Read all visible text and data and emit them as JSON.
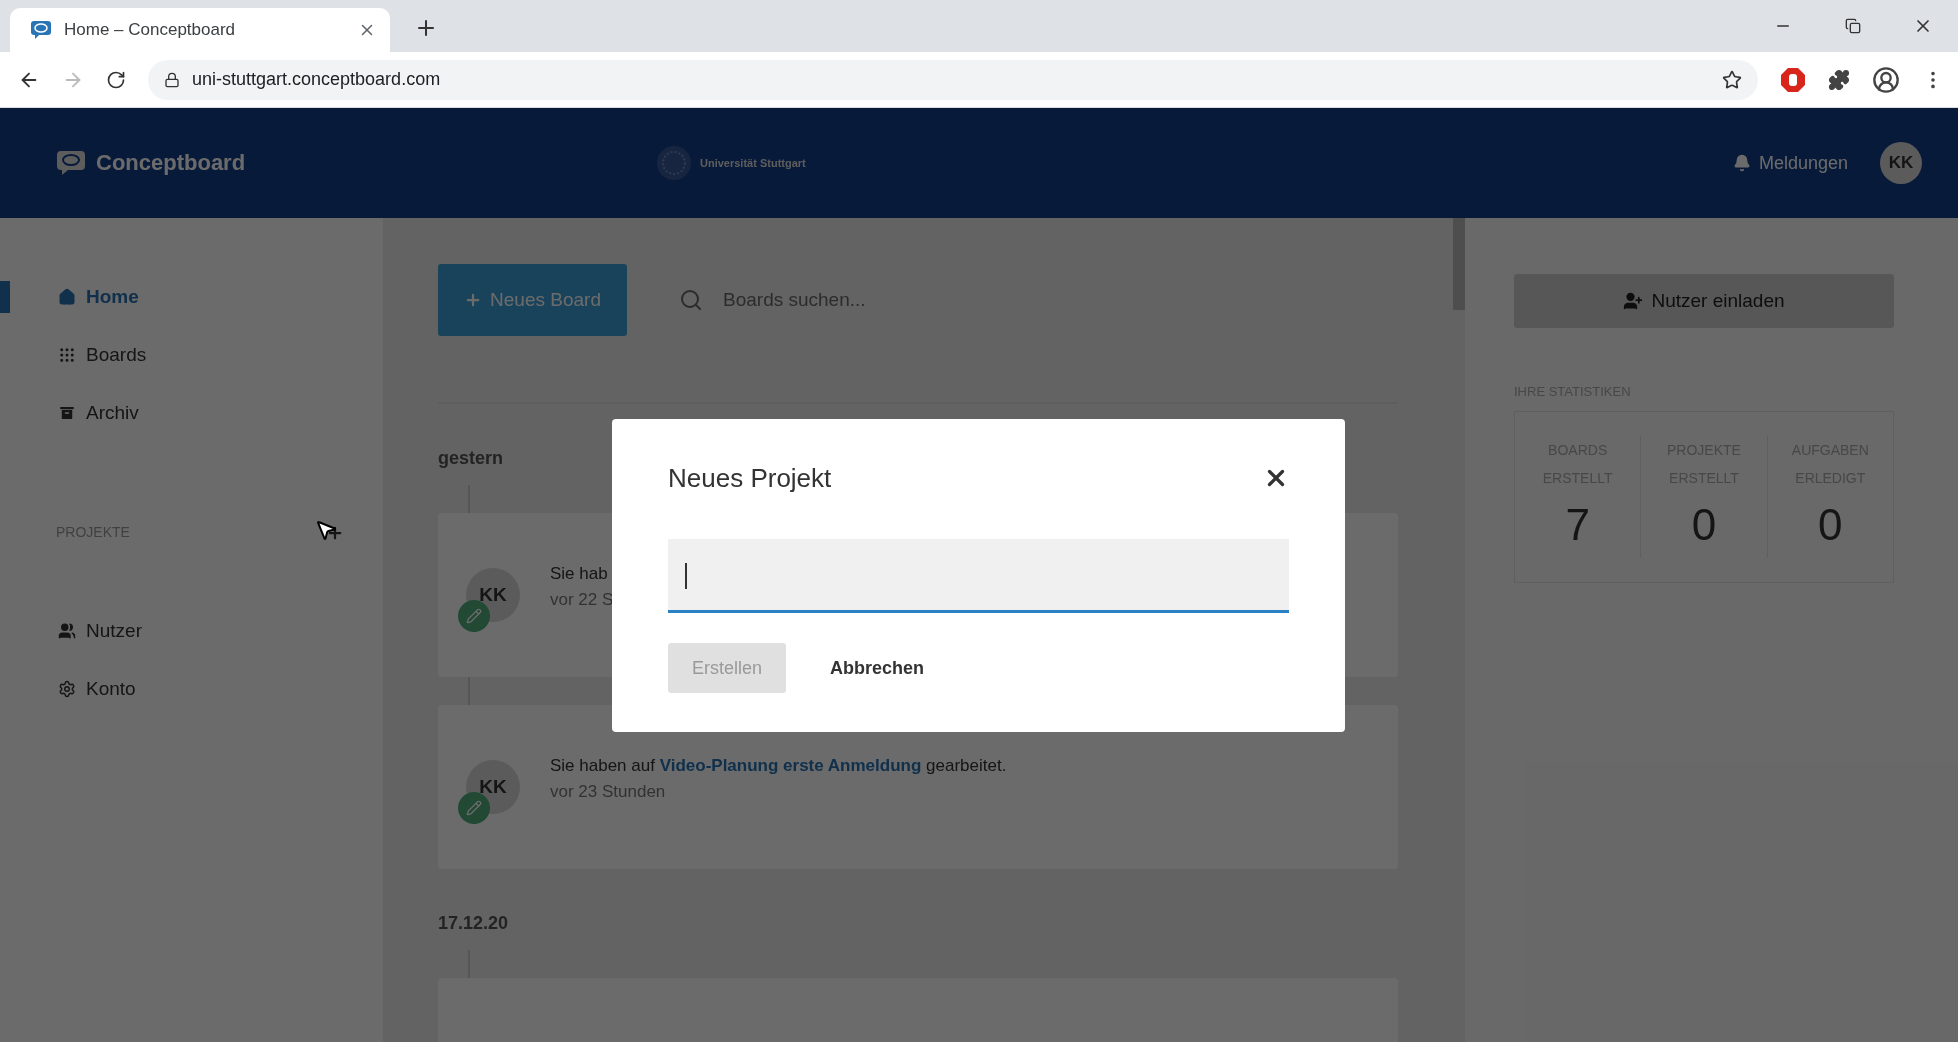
{
  "browser": {
    "tab_title": "Home – Conceptboard",
    "url": "uni-stuttgart.conceptboard.com"
  },
  "header": {
    "brand": "Conceptboard",
    "center_logo": "Universität Stuttgart",
    "notifications": "Meldungen",
    "avatar": "KK"
  },
  "sidebar": {
    "items": [
      {
        "label": "Home",
        "selected": true
      },
      {
        "label": "Boards",
        "selected": false
      },
      {
        "label": "Archiv",
        "selected": false
      }
    ],
    "projects_heading": "PROJEKTE",
    "bottom_items": [
      {
        "label": "Nutzer",
        "selected": false
      },
      {
        "label": "Konto",
        "selected": false
      }
    ]
  },
  "main": {
    "new_board_button": "Neues Board",
    "search": {
      "placeholder": "Boards suchen..."
    },
    "feed": [
      {
        "date": "gestern",
        "activities": [
          {
            "avatar": "KK",
            "prefix": "Sie hab",
            "time": "vor 22 S"
          },
          {
            "avatar": "KK",
            "prefix": "Sie haben auf",
            "link": "Video-Planung erste Anmeldung",
            "suffix": "gearbeitet.",
            "time": "vor 23 Stunden"
          }
        ]
      },
      {
        "date": "17.12.20",
        "partial_card": true
      }
    ]
  },
  "right_panel": {
    "invite_button": "Nutzer einladen",
    "stats_heading": "IHRE STATISTIKEN",
    "stats": [
      {
        "label": "BOARDS ERSTELLT",
        "value": "7"
      },
      {
        "label": "PROJEKTE ERSTELLT",
        "value": "0"
      },
      {
        "label": "AUFGABEN ERLEDIGT",
        "value": "0"
      }
    ]
  },
  "modal": {
    "title": "Neues Projekt",
    "buttons": [
      {
        "label": "Erstellen",
        "kind": "primary",
        "disabled": true
      },
      {
        "label": "Abbrechen",
        "kind": "cancel"
      }
    ]
  }
}
